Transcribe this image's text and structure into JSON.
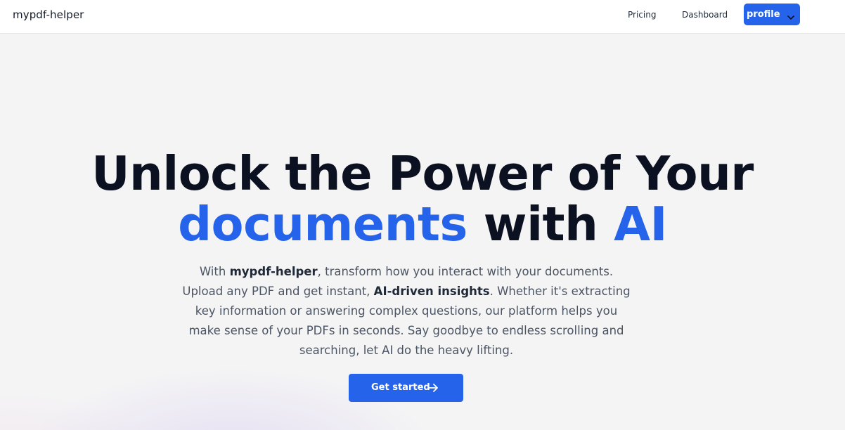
{
  "navbar": {
    "brand": "mypdf-helper",
    "links": [
      {
        "label": "Pricing"
      },
      {
        "label": "Dashboard"
      }
    ],
    "profile_button": {
      "label": "profile",
      "icon": "chevron-down-icon"
    }
  },
  "hero": {
    "headline": {
      "line1": "Unlock the Power of Your",
      "line2_accent_1": "documents",
      "line2_middle": " with ",
      "line2_accent_2": "AI"
    },
    "description": {
      "part1": "With ",
      "bold1": "mypdf-helper",
      "part2": ", transform how you interact with your documents. Upload any PDF and get instant, ",
      "bold2": "AI-driven insights",
      "part3": ". Whether it's extracting key information or answering complex questions, our platform helps you make sense of your PDFs in seconds. Say goodbye to endless scrolling and searching, let AI do the heavy lifting."
    },
    "cta": {
      "label": "Get started",
      "icon": "arrow-right-icon"
    }
  },
  "colors": {
    "accent": "#2563eb",
    "heading": "#0b1120",
    "body_text": "#4b5563",
    "background": "#f4f4f5"
  }
}
